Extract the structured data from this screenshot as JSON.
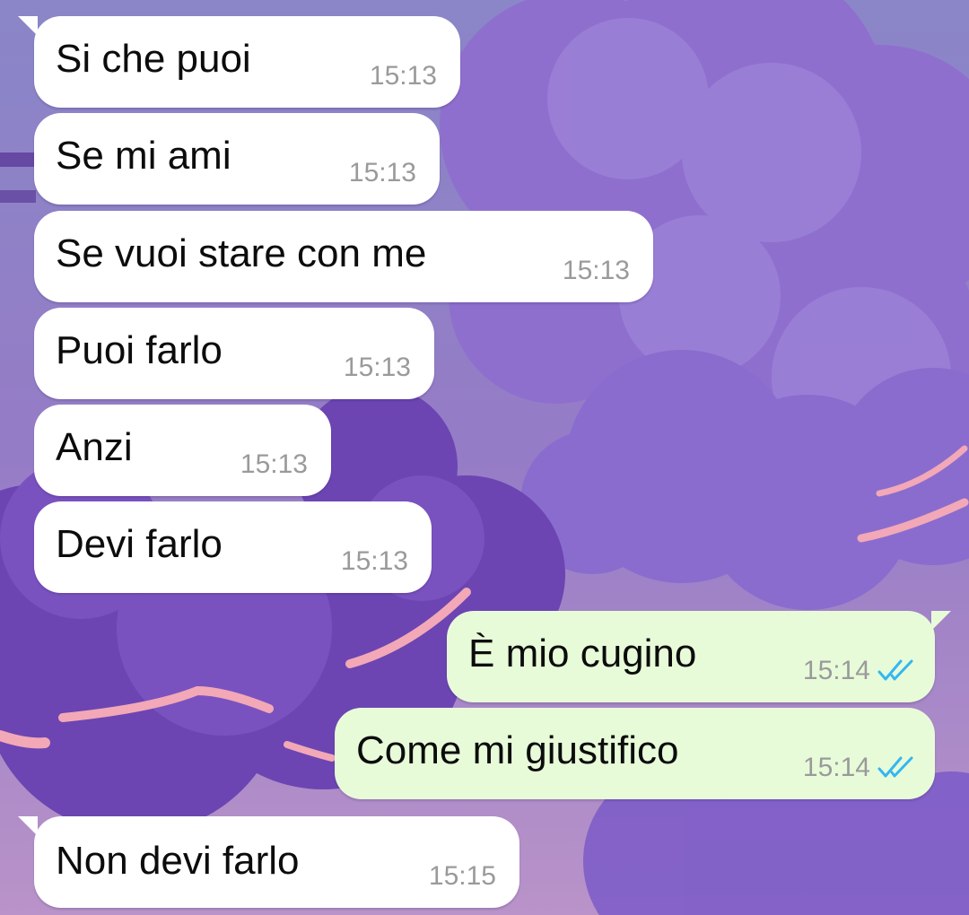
{
  "colors": {
    "incoming_bubble": "#ffffff",
    "outgoing_bubble": "#e8fbd9",
    "timestamp": "#9a9a9a",
    "read_ticks": "#34b7f1",
    "wallpaper_base": "#8f78c9"
  },
  "messages": [
    {
      "text": "Si che puoi",
      "time": "15:13",
      "direction": "incoming"
    },
    {
      "text": "Se mi ami",
      "time": "15:13",
      "direction": "incoming"
    },
    {
      "text": "Se vuoi stare con me",
      "time": "15:13",
      "direction": "incoming"
    },
    {
      "text": "Puoi farlo",
      "time": "15:13",
      "direction": "incoming"
    },
    {
      "text": "Anzi",
      "time": "15:13",
      "direction": "incoming"
    },
    {
      "text": "Devi farlo",
      "time": "15:13",
      "direction": "incoming"
    },
    {
      "text": "È mio cugino",
      "time": "15:14",
      "direction": "outgoing",
      "status_icon": "double-check-read-icon"
    },
    {
      "text": "Come mi giustifico",
      "time": "15:14",
      "direction": "outgoing",
      "status_icon": "double-check-read-icon"
    },
    {
      "text": "Non devi farlo",
      "time": "15:15",
      "direction": "incoming"
    }
  ]
}
